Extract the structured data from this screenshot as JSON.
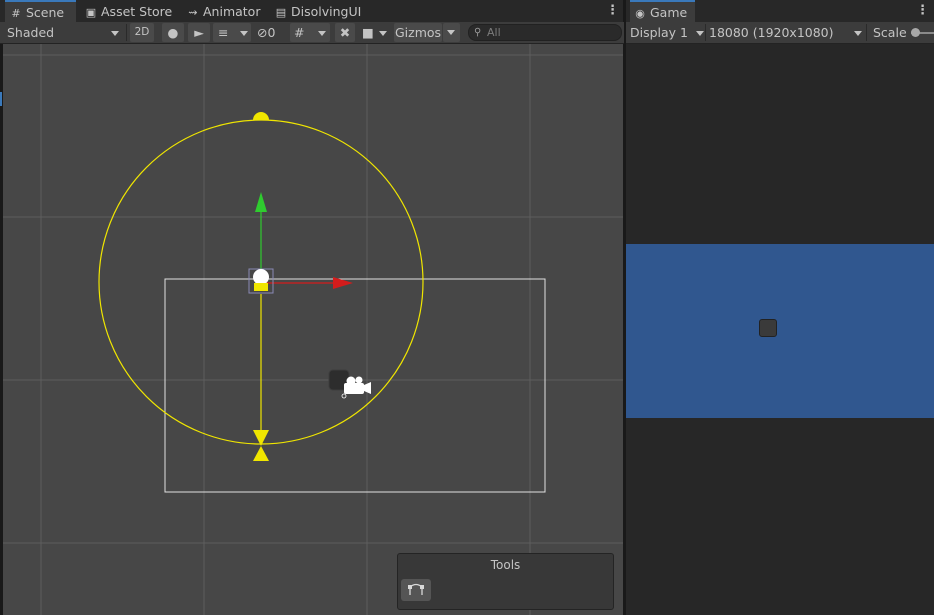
{
  "scene_panel": {
    "tabs": [
      {
        "label": "Scene",
        "icon": "grid-icon"
      },
      {
        "label": "Asset Store",
        "icon": "shopping-bag-icon"
      },
      {
        "label": "Animator",
        "icon": "animator-icon"
      },
      {
        "label": "DisolvingUI",
        "icon": "lock-document-icon"
      }
    ],
    "toolbar": {
      "shading_mode": "Shaded",
      "toggle_2d": "2D",
      "hidden_count": "0",
      "gizmos": "Gizmos",
      "search_placeholder": "All"
    },
    "tools_overlay": {
      "title": "Tools"
    }
  },
  "game_panel": {
    "tab": {
      "label": "Game",
      "icon": "gamepad-icon"
    },
    "toolbar": {
      "display": "Display 1",
      "resolution": "18080 (1920x1080)",
      "scale_label": "Scale"
    },
    "game_view_background": "#30578f"
  },
  "colors": {
    "editor_background": "#474747",
    "grid_line": "#5f5f5f",
    "light_gizmo": "#f2ea00",
    "axis_y": "#28c828",
    "axis_x": "#d21a1a",
    "camera_frame": "#e6e6e6",
    "tab_accent": "#3a79bb"
  }
}
